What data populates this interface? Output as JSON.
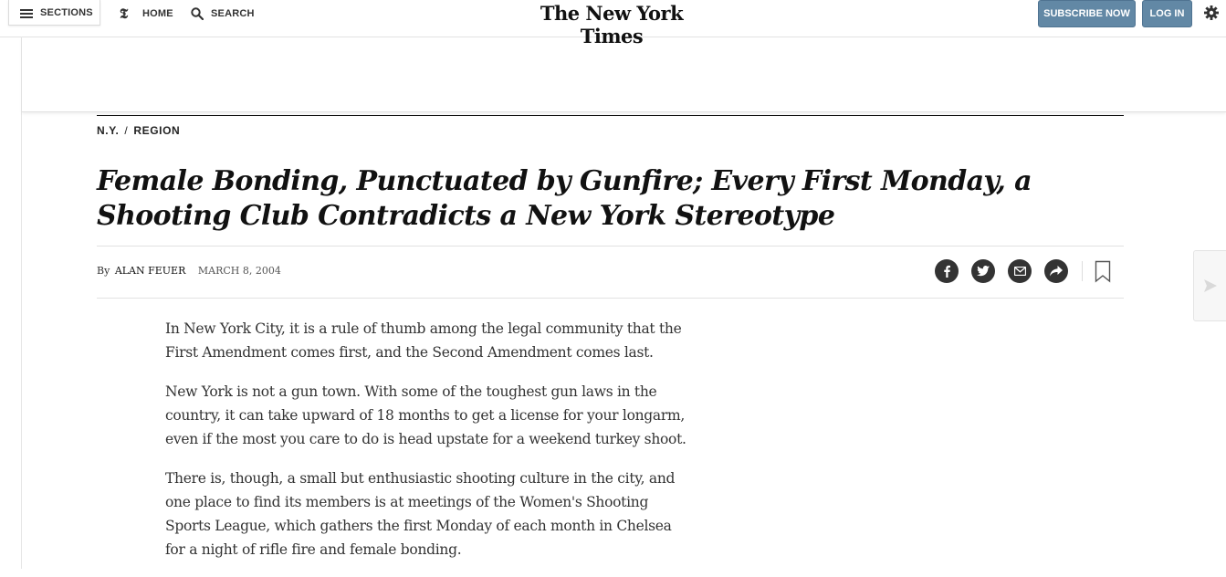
{
  "header": {
    "sections_label": "SECTIONS",
    "home_label": "HOME",
    "search_label": "SEARCH",
    "logo_text": "The New York Times",
    "subscribe_label": "SUBSCRIBE NOW",
    "login_label": "LOG IN",
    "accent_color": "#6288a5"
  },
  "article": {
    "kicker_primary": "N.Y.",
    "kicker_separator": "/",
    "kicker_secondary": "REGION",
    "headline": "Female Bonding, Punctuated by Gunfire; Every First Monday, a Shooting Club Contradicts a New York Stereotype",
    "byline_prefix": "By",
    "author": "ALAN FEUER",
    "date": "MARCH 8, 2004",
    "share_icons": [
      "facebook-icon",
      "twitter-icon",
      "email-icon",
      "share-icon",
      "bookmark-icon"
    ],
    "paragraphs": [
      "In New York City, it is a rule of thumb among the legal community that the First Amendment comes first, and the Second Amendment comes last.",
      "New York is not a gun town. With some of the toughest gun laws in the country, it can take upward of 18 months to get a license for your longarm, even if the most you care to do is head upstate for a weekend turkey shoot.",
      "There is, though, a small but enthusiastic shooting culture in the city, and one place to find its members is at meetings of the Women's Shooting Sports League, which gathers the first Monday of each month in Chelsea for a night of rifle fire and female bonding."
    ]
  }
}
